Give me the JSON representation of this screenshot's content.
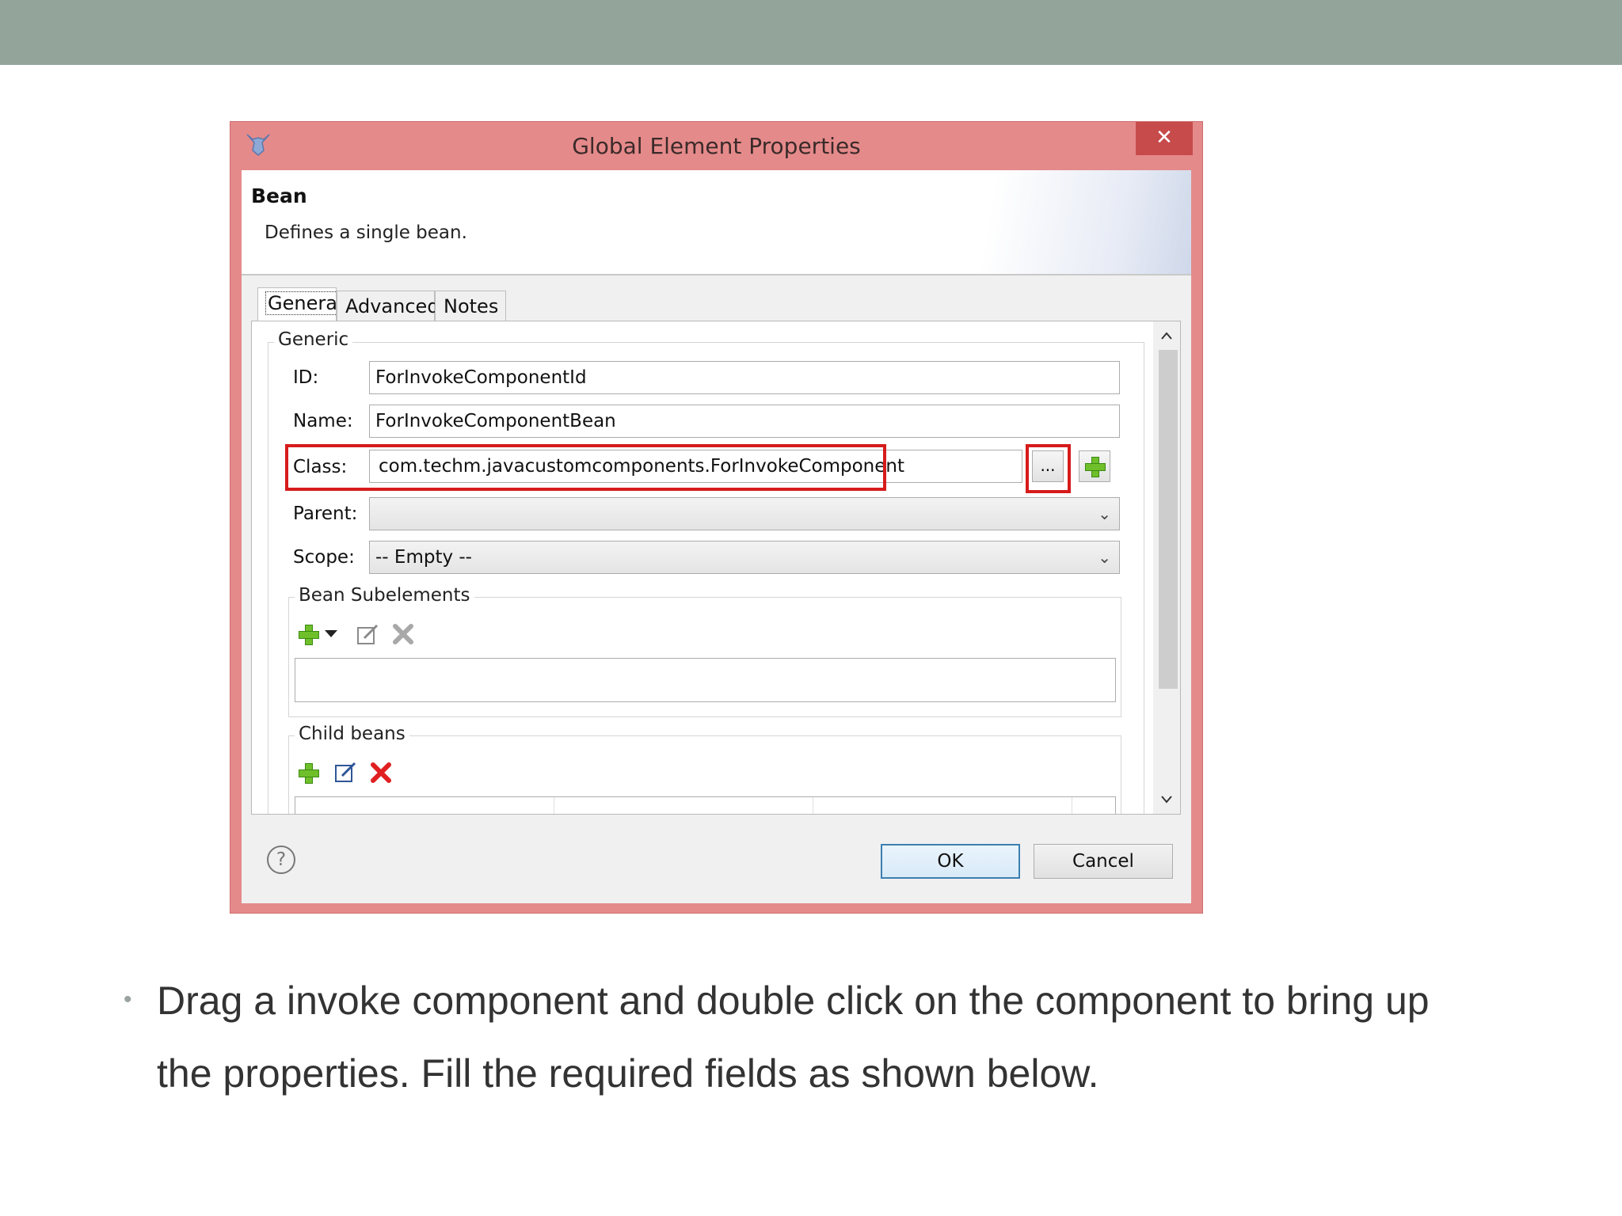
{
  "dialog": {
    "title": "Global Element Properties",
    "close_glyph": "✕",
    "header_title": "Bean",
    "header_desc": "Defines a single bean.",
    "tabs": [
      {
        "label": "General",
        "active": true
      },
      {
        "label": "Advanced",
        "active": false
      },
      {
        "label": "Notes",
        "active": false
      }
    ],
    "generic_group": "Generic",
    "fields": {
      "id": {
        "label": "ID:",
        "value": "ForInvokeComponentId"
      },
      "name": {
        "label": "Name:",
        "value": "ForInvokeComponentBean"
      },
      "class": {
        "label": "Class:",
        "value": "com.techm.javacustomcomponents.ForInvokeComponent",
        "browse_label": "..."
      },
      "parent": {
        "label": "Parent:",
        "value": ""
      },
      "scope": {
        "label": "Scope:",
        "value": "-- Empty --"
      }
    },
    "subelements_group": "Bean Subelements",
    "child_beans_group": "Child beans",
    "buttons": {
      "ok": "OK",
      "cancel": "Cancel"
    },
    "help_glyph": "?"
  },
  "colors": {
    "title_bar": "#e58a8a",
    "close_button": "#c74b4b",
    "highlight": "#d61b1b",
    "top_band": "#93a59b"
  },
  "bullet": {
    "marker": "•",
    "text": "Drag a invoke component and double click on the component to bring up the properties. Fill the required fields as shown below."
  }
}
